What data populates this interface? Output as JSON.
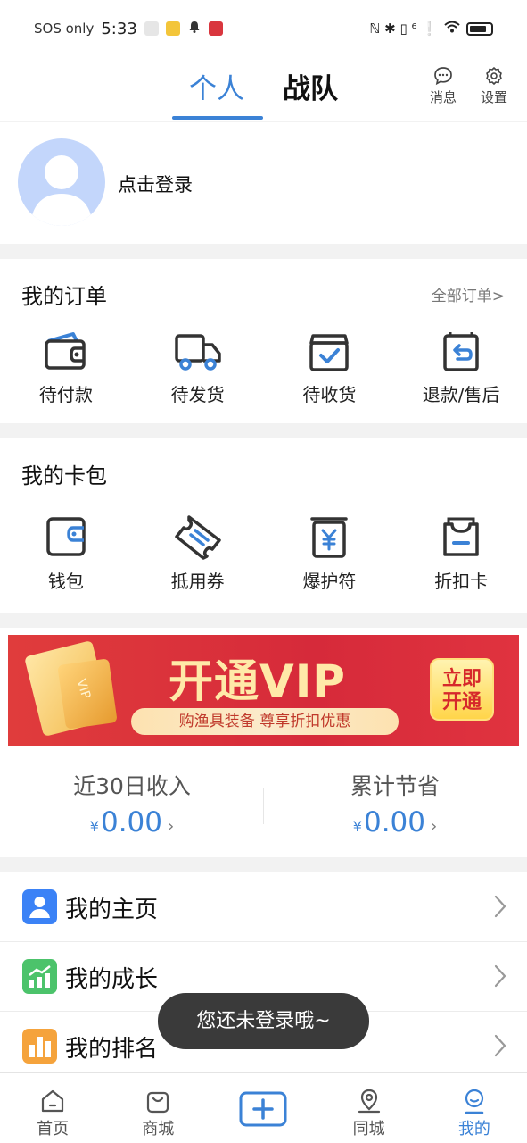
{
  "status_bar": {
    "carrier": "SOS only",
    "time": "5:33",
    "right_text": "ℕ ✱ ▯ ⁶ ❕"
  },
  "header": {
    "tab_personal": "个人",
    "tab_team": "战队",
    "messages_label": "消息",
    "settings_label": "设置"
  },
  "profile": {
    "login_prompt": "点击登录"
  },
  "orders": {
    "title": "我的订单",
    "all_orders": "全部订单>",
    "items": [
      {
        "label": "待付款",
        "icon": "wallet-icon"
      },
      {
        "label": "待发货",
        "icon": "truck-icon"
      },
      {
        "label": "待收货",
        "icon": "box-check-icon"
      },
      {
        "label": "退款/售后",
        "icon": "return-icon"
      }
    ]
  },
  "card_wallet": {
    "title": "我的卡包",
    "items": [
      {
        "label": "钱包",
        "icon": "wallet-icon"
      },
      {
        "label": "抵用券",
        "icon": "ticket-icon"
      },
      {
        "label": "爆护符",
        "icon": "yen-bag-icon"
      },
      {
        "label": "折扣卡",
        "icon": "discount-card-icon"
      }
    ]
  },
  "vip_banner": {
    "title": "开通VIP",
    "subtitle": "购渔具装备  尊享折扣优惠",
    "button_line1": "立即",
    "button_line2": "开通",
    "card_text": "VIP"
  },
  "stats": {
    "income_label": "近30日收入",
    "income_currency": "¥",
    "income_value": "0.00",
    "saved_label": "累计节省",
    "saved_currency": "¥",
    "saved_value": "0.00",
    "arrow": "›"
  },
  "menu": {
    "items": [
      {
        "label": "我的主页",
        "icon": "user-icon",
        "color": "#3b82f6"
      },
      {
        "label": "我的成长",
        "icon": "growth-chart-icon",
        "color": "#4cc36b"
      },
      {
        "label": "我的排名",
        "icon": "ranking-bar-icon",
        "color": "#f5a33c"
      }
    ]
  },
  "toast": {
    "message": "您还未登录哦~"
  },
  "bottom_nav": {
    "items": [
      {
        "label": "首页",
        "icon": "home-icon"
      },
      {
        "label": "商城",
        "icon": "shop-bag-icon"
      },
      {
        "label": "",
        "icon": "plus-icon"
      },
      {
        "label": "同城",
        "icon": "location-icon"
      },
      {
        "label": "我的",
        "icon": "profile-icon"
      }
    ],
    "active_color": "#3b82d6"
  }
}
